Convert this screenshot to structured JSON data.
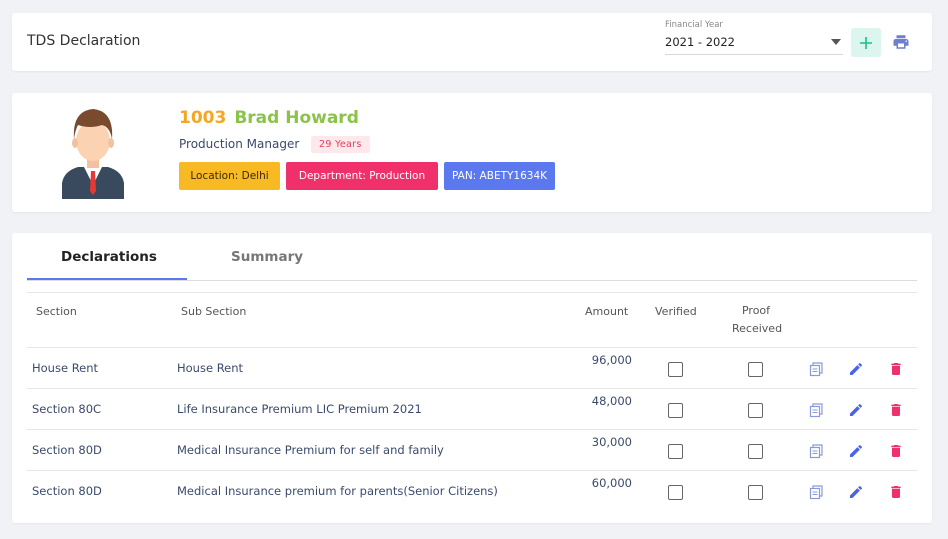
{
  "header": {
    "title": "TDS Declaration",
    "financial_year": {
      "label": "Financial Year",
      "value": "2021 - 2022"
    },
    "add_icon": "plus-icon",
    "print_icon": "printer-icon"
  },
  "employee": {
    "id": "1003",
    "name": "Brad Howard",
    "designation": "Production Manager",
    "age": "29 Years",
    "tags": {
      "location": "Location: Delhi",
      "department": "Department: Production",
      "pan": "PAN: ABETY1634K"
    },
    "colors": {
      "id": "#f5a623",
      "name": "#8bc34a",
      "location": "#f7b924",
      "department": "#f0306a",
      "pan": "#5b78ef"
    }
  },
  "tabs": [
    {
      "label": "Declarations",
      "active": true
    },
    {
      "label": "Summary",
      "active": false
    }
  ],
  "table": {
    "columns": {
      "section": "Section",
      "sub_section": "Sub Section",
      "amount": "Amount",
      "verified": "Verified",
      "proof_line1": "Proof",
      "proof_line2": "Received"
    },
    "rows": [
      {
        "section": "House Rent",
        "sub_section": "House Rent",
        "amount": "96,000",
        "verified": false,
        "proof_received": false
      },
      {
        "section": "Section 80C",
        "sub_section": "Life Insurance Premium  LIC Premium 2021",
        "amount": "48,000",
        "verified": false,
        "proof_received": false
      },
      {
        "section": "Section 80D",
        "sub_section": "Medical Insurance Premium for self and family",
        "amount": "30,000",
        "verified": false,
        "proof_received": false
      },
      {
        "section": "Section 80D",
        "sub_section": "Medical Insurance premium for parents(Senior Citizens)",
        "amount": "60,000",
        "verified": false,
        "proof_received": false
      }
    ],
    "row_actions": [
      "copy-icon",
      "edit-icon",
      "delete-icon"
    ]
  }
}
